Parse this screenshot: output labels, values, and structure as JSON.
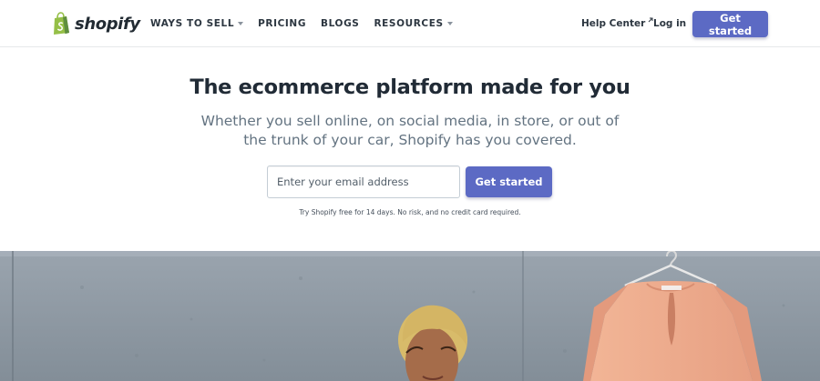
{
  "header": {
    "logo_text": "shopify",
    "logo_icon": "shopping-bag-icon",
    "nav": [
      {
        "label": "WAYS TO SELL",
        "has_dropdown": true
      },
      {
        "label": "PRICING",
        "has_dropdown": false
      },
      {
        "label": "BLOGS",
        "has_dropdown": false
      },
      {
        "label": "RESOURCES",
        "has_dropdown": true
      }
    ],
    "help_center_label": "Help Center",
    "help_center_icon": "external-link-icon",
    "login_label": "Log in",
    "cta_label": "Get started"
  },
  "hero": {
    "title": "The ecommerce platform made for you",
    "subtitle_line1": "Whether you sell online, on social media, in store, or out of",
    "subtitle_line2": "the trunk of your car, Shopify has you covered.",
    "email_placeholder": "Enter your email address",
    "cta_label": "Get started",
    "disclaimer": "Try Shopify free for 14 days. No risk, and no credit card required."
  },
  "colors": {
    "brand_green": "#95bf47",
    "accent": "#5c6ac4",
    "heading": "#212b36",
    "subtext": "#637381",
    "photo_wall": "#8c97a1",
    "blouse": "#efab8d"
  }
}
